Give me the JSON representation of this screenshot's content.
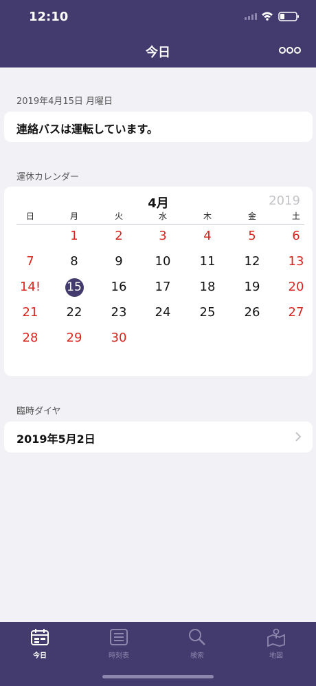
{
  "status_bar": {
    "time": "12:10"
  },
  "nav": {
    "title": "今日",
    "more_icon": "more-icon"
  },
  "today_section": {
    "date_label": "2019年4月15日 月曜日",
    "status_text": "連絡バスは運転しています。"
  },
  "calendar": {
    "section_label": "運休カレンダー",
    "month": "4月",
    "year": "2019",
    "weekdays": [
      "日",
      "月",
      "火",
      "水",
      "木",
      "金",
      "土"
    ],
    "weeks": [
      [
        "",
        "1",
        "2",
        "3",
        "4",
        "5",
        "6"
      ],
      [
        "7",
        "8",
        "9",
        "10",
        "11",
        "12",
        "13"
      ],
      [
        "14!",
        "15",
        "16",
        "17",
        "18",
        "19",
        "20"
      ],
      [
        "21",
        "22",
        "23",
        "24",
        "25",
        "26",
        "27"
      ],
      [
        "28",
        "29",
        "30",
        "",
        "",
        "",
        ""
      ]
    ],
    "today": "15",
    "colors": {
      "holiday": "#d9251d",
      "today_circle": "#433b6e"
    }
  },
  "special_schedule": {
    "section_label": "臨時ダイヤ",
    "date": "2019年5月2日"
  },
  "tabbar": {
    "tabs": [
      {
        "label": "今日",
        "icon": "calendar-icon",
        "active": true
      },
      {
        "label": "時刻表",
        "icon": "list-icon",
        "active": false
      },
      {
        "label": "検索",
        "icon": "search-icon",
        "active": false
      },
      {
        "label": "地図",
        "icon": "map-icon",
        "active": false
      }
    ]
  },
  "colors": {
    "header": "#433b6e",
    "background": "#f2f2f6"
  }
}
